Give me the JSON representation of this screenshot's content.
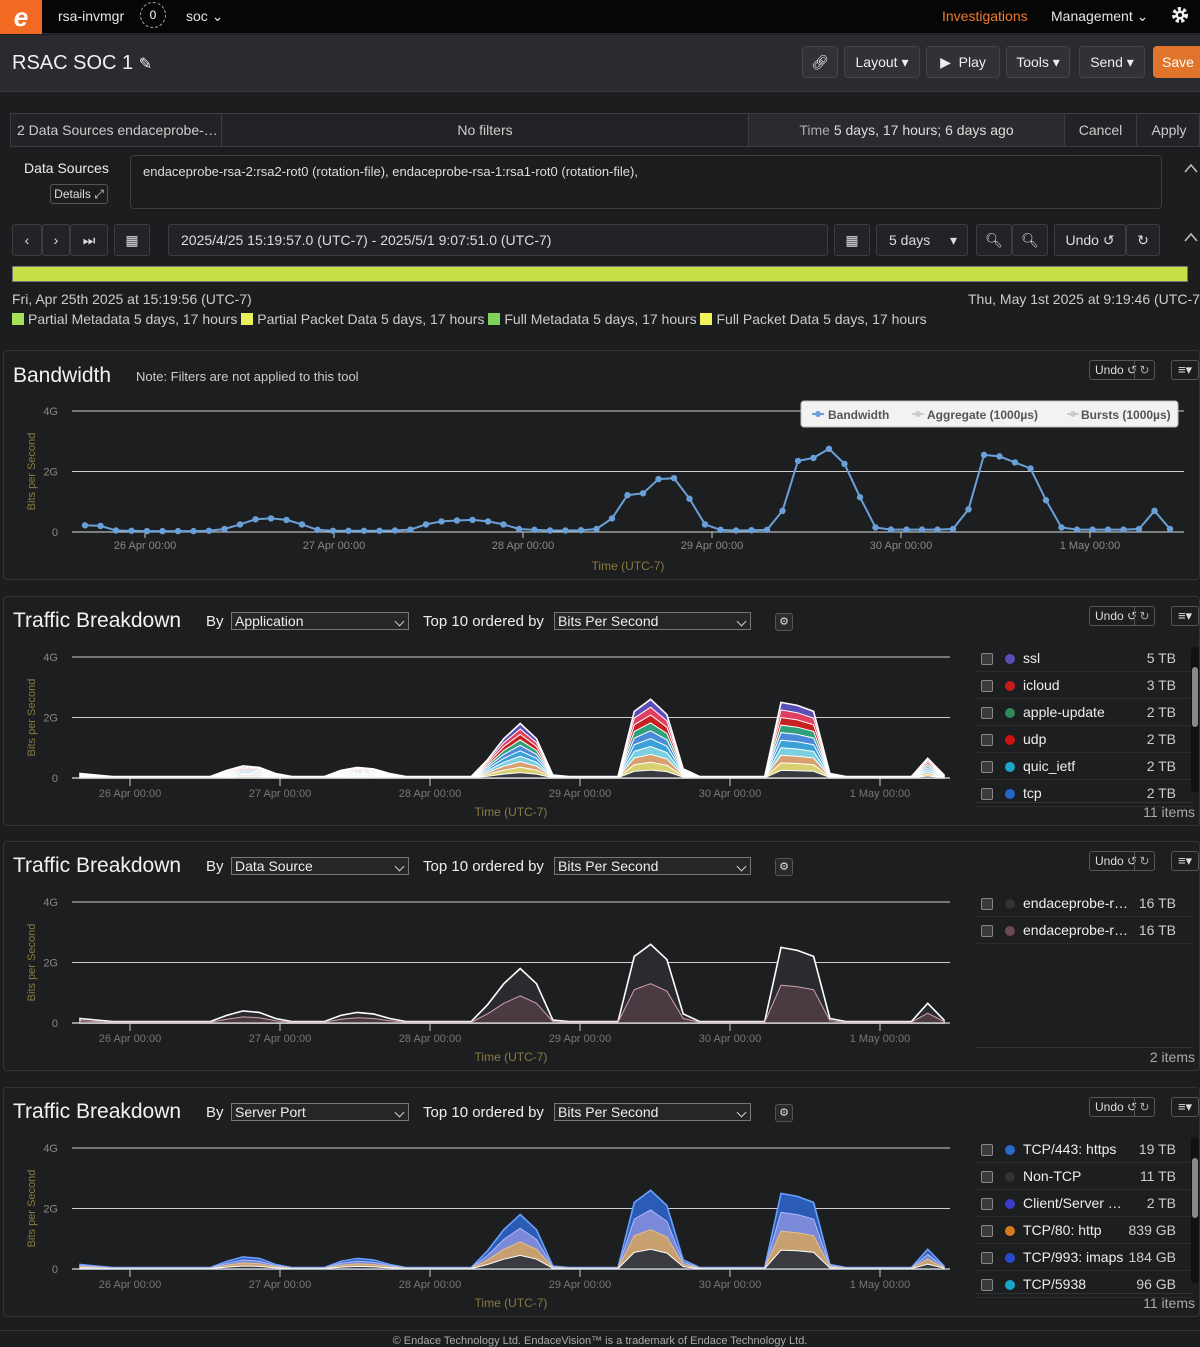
{
  "topbar": {
    "user": "rsa-invmgr",
    "badge": "0",
    "workspace": "soc",
    "investigations": "Investigations",
    "management": "Management"
  },
  "titlebar": {
    "title": "RSAC SOC 1",
    "layout": "Layout",
    "play": "Play",
    "tools": "Tools",
    "send": "Send",
    "save": "Save"
  },
  "filterbar": {
    "sources": "2 Data Sources endaceprobe-…",
    "filters": "No filters",
    "time_label": "Time",
    "time_value": "5 days, 17 hours; 6 days ago",
    "cancel": "Cancel",
    "apply": "Apply"
  },
  "datasources": {
    "label": "Data Sources",
    "details": "Details",
    "list": "endaceprobe-rsa-2:rsa2-rot0 (rotation-file), endaceprobe-rsa-1:rsa1-rot0 (rotation-file),"
  },
  "timenav": {
    "range": "2025/4/25 15:19:57.0 (UTC-7) - 2025/5/1 9:07:51.0 (UTC-7)",
    "duration": "5 days",
    "undo": "Undo"
  },
  "timeline": {
    "start": "Fri, Apr 25th 2025 at 15:19:56 (UTC-7)",
    "end": "Thu, May 1st 2025 at 9:19:46 (UTC-7)",
    "legend": [
      {
        "color": "#a6e05a",
        "label": "Partial Metadata 5 days, 17 hours"
      },
      {
        "color": "#eaf05a",
        "label": "Partial Packet Data 5 days, 17 hours"
      },
      {
        "color": "#7fd35a",
        "label": "Full Metadata 5 days, 17 hours"
      },
      {
        "color": "#f2f25a",
        "label": "Full Packet Data 5 days, 17 hours"
      }
    ]
  },
  "bandwidth": {
    "title": "Bandwidth",
    "note": "Note: Filters are not applied to this tool",
    "undo": "Undo",
    "legend": [
      "Bandwidth",
      "Aggregate (1000µs)",
      "Bursts (1000µs)"
    ]
  },
  "common": {
    "by": "By",
    "top": "Top 10 ordered by",
    "order": "Bits Per Second",
    "undo": "Undo"
  },
  "breakdowns": [
    {
      "title": "Traffic Breakdown",
      "by": "Application",
      "items": "11 items",
      "rows": [
        {
          "name": "ssl",
          "value": "5 TB",
          "color": "#5a4db5"
        },
        {
          "name": "icloud",
          "value": "3 TB",
          "color": "#c81a1a"
        },
        {
          "name": "apple-update",
          "value": "2 TB",
          "color": "#2e8a5a"
        },
        {
          "name": "udp",
          "value": "2 TB",
          "color": "#cc1111"
        },
        {
          "name": "quic_ietf",
          "value": "2 TB",
          "color": "#1aa6c8"
        },
        {
          "name": "tcp",
          "value": "2 TB",
          "color": "#2266cc"
        }
      ]
    },
    {
      "title": "Traffic Breakdown",
      "by": "Data Source",
      "items": "2 items",
      "rows": [
        {
          "name": "endaceprobe-r…",
          "value": "16 TB",
          "color": "#333333"
        },
        {
          "name": "endaceprobe-r…",
          "value": "16 TB",
          "color": "#6b4a55"
        }
      ]
    },
    {
      "title": "Traffic Breakdown",
      "by": "Server Port",
      "items": "11 items",
      "rows": [
        {
          "name": "TCP/443: https",
          "value": "19 TB",
          "color": "#2a6acc"
        },
        {
          "name": "Non-TCP",
          "value": "11 TB",
          "color": "#333333"
        },
        {
          "name": "Client/Server …",
          "value": "2 TB",
          "color": "#3a3acc"
        },
        {
          "name": "TCP/80: http",
          "value": "839 GB",
          "color": "#d87a1a"
        },
        {
          "name": "TCP/993: imaps",
          "value": "184 GB",
          "color": "#2a4acc"
        },
        {
          "name": "TCP/5938",
          "value": "96 GB",
          "color": "#1aa6c8"
        }
      ]
    }
  ],
  "footer": "© Endace Technology Ltd. EndaceVision™ is a trademark of Endace Technology Ltd.",
  "chart_data": [
    {
      "type": "line",
      "title": "Bandwidth",
      "xlabel": "Time (UTC-7)",
      "ylabel": "Bits per Second",
      "y_ticks": [
        "4G",
        "2G",
        "0"
      ],
      "ylim": [
        0,
        4
      ],
      "x_ticks": [
        "26 Apr 00:00",
        "27 Apr 00:00",
        "28 Apr 00:00",
        "29 Apr 00:00",
        "30 Apr 00:00",
        "1 May 00:00"
      ],
      "series": [
        {
          "name": "Bandwidth",
          "values": [
            0.22,
            0.2,
            0.05,
            0.04,
            0.03,
            0.03,
            0.03,
            0.03,
            0.04,
            0.1,
            0.25,
            0.42,
            0.45,
            0.4,
            0.25,
            0.07,
            0.04,
            0.04,
            0.04,
            0.04,
            0.05,
            0.08,
            0.25,
            0.35,
            0.38,
            0.4,
            0.35,
            0.25,
            0.1,
            0.07,
            0.05,
            0.05,
            0.06,
            0.1,
            0.45,
            1.22,
            1.28,
            1.75,
            1.78,
            1.1,
            0.25,
            0.07,
            0.05,
            0.06,
            0.07,
            0.7,
            2.35,
            2.45,
            2.75,
            2.25,
            1.15,
            0.15,
            0.08,
            0.08,
            0.08,
            0.08,
            0.1,
            0.75,
            2.55,
            2.5,
            2.3,
            2.1,
            1.05,
            0.15,
            0.08,
            0.08,
            0.08,
            0.08,
            0.1,
            0.7,
            0.1
          ]
        }
      ]
    },
    {
      "type": "area",
      "title": "Traffic Breakdown - Application",
      "xlabel": "Time (UTC-7)",
      "ylabel": "Bits per Second",
      "y_ticks": [
        "4G",
        "2G",
        "0"
      ],
      "ylim": [
        0,
        4
      ],
      "x_ticks": [
        "26 Apr 00:00",
        "27 Apr 00:00",
        "28 Apr 00:00",
        "29 Apr 00:00",
        "30 Apr 00:00",
        "1 May 00:00"
      ],
      "series_names": [
        "ssl",
        "icloud",
        "apple-update",
        "udp",
        "quic_ietf",
        "tcp"
      ],
      "total": [
        0.15,
        0.1,
        0.05,
        0.05,
        0.05,
        0.05,
        0.05,
        0.05,
        0.05,
        0.25,
        0.4,
        0.35,
        0.15,
        0.05,
        0.05,
        0.05,
        0.25,
        0.35,
        0.3,
        0.15,
        0.05,
        0.05,
        0.05,
        0.05,
        0.05,
        0.6,
        1.3,
        1.8,
        1.3,
        0.1,
        0.05,
        0.05,
        0.05,
        0.05,
        2.2,
        2.6,
        2.1,
        0.3,
        0.05,
        0.05,
        0.05,
        0.05,
        0.05,
        2.5,
        2.4,
        2.2,
        0.15,
        0.05,
        0.05,
        0.05,
        0.05,
        0.05,
        0.65,
        0.1
      ]
    },
    {
      "type": "area",
      "title": "Traffic Breakdown - Data Source",
      "xlabel": "Time (UTC-7)",
      "ylabel": "Bits per Second",
      "y_ticks": [
        "4G",
        "2G",
        "0"
      ],
      "ylim": [
        0,
        4
      ],
      "x_ticks": [
        "26 Apr 00:00",
        "27 Apr 00:00",
        "28 Apr 00:00",
        "29 Apr 00:00",
        "30 Apr 00:00",
        "1 May 00:00"
      ],
      "series_names": [
        "endaceprobe-r…",
        "endaceprobe-r…"
      ],
      "total": [
        0.15,
        0.1,
        0.05,
        0.05,
        0.05,
        0.05,
        0.05,
        0.05,
        0.05,
        0.25,
        0.4,
        0.35,
        0.15,
        0.05,
        0.05,
        0.05,
        0.25,
        0.35,
        0.3,
        0.15,
        0.05,
        0.05,
        0.05,
        0.05,
        0.05,
        0.6,
        1.3,
        1.8,
        1.3,
        0.1,
        0.05,
        0.05,
        0.05,
        0.05,
        2.2,
        2.6,
        2.1,
        0.3,
        0.05,
        0.05,
        0.05,
        0.05,
        0.05,
        2.5,
        2.4,
        2.2,
        0.15,
        0.05,
        0.05,
        0.05,
        0.05,
        0.05,
        0.65,
        0.1
      ]
    },
    {
      "type": "area",
      "title": "Traffic Breakdown - Server Port",
      "xlabel": "Time (UTC-7)",
      "ylabel": "Bits per Second",
      "y_ticks": [
        "4G",
        "2G",
        "0"
      ],
      "ylim": [
        0,
        4
      ],
      "x_ticks": [
        "26 Apr 00:00",
        "27 Apr 00:00",
        "28 Apr 00:00",
        "29 Apr 00:00",
        "30 Apr 00:00",
        "1 May 00:00"
      ],
      "series_names": [
        "TCP/443: https",
        "Non-TCP",
        "Client/Server …",
        "TCP/80: http",
        "TCP/993: imaps",
        "TCP/5938"
      ],
      "total": [
        0.15,
        0.1,
        0.05,
        0.05,
        0.05,
        0.05,
        0.05,
        0.05,
        0.05,
        0.25,
        0.4,
        0.35,
        0.15,
        0.05,
        0.05,
        0.05,
        0.25,
        0.35,
        0.3,
        0.15,
        0.05,
        0.05,
        0.05,
        0.05,
        0.05,
        0.6,
        1.3,
        1.8,
        1.3,
        0.1,
        0.05,
        0.05,
        0.05,
        0.05,
        2.2,
        2.6,
        2.1,
        0.3,
        0.05,
        0.05,
        0.05,
        0.05,
        0.05,
        2.5,
        2.4,
        2.2,
        0.15,
        0.05,
        0.05,
        0.05,
        0.05,
        0.05,
        0.65,
        0.1
      ]
    }
  ]
}
